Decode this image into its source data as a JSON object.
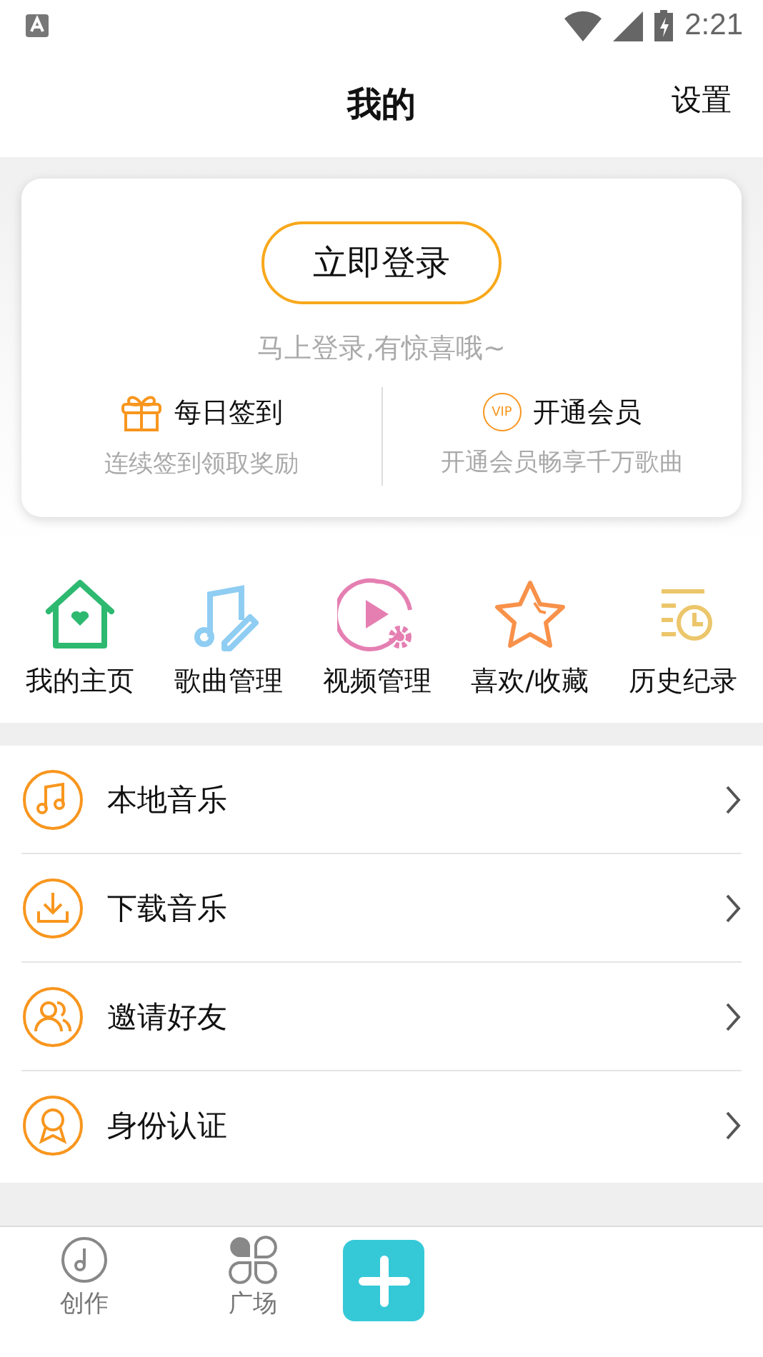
{
  "status_bar": {
    "time": "2:21"
  },
  "header": {
    "title": "我的",
    "action": "设置"
  },
  "login_card": {
    "button": "立即登录",
    "hint": "马上登录,有惊喜哦~",
    "features": [
      {
        "kind": "gift",
        "title": "每日签到",
        "subtitle": "连续签到领取奖励"
      },
      {
        "kind": "vip",
        "badge": "VIP",
        "title": "开通会员",
        "subtitle": "开通会员畅享千万歌曲"
      }
    ]
  },
  "shortcuts": [
    {
      "kind": "home",
      "label": "我的主页"
    },
    {
      "kind": "music",
      "label": "歌曲管理"
    },
    {
      "kind": "video",
      "label": "视频管理"
    },
    {
      "kind": "star",
      "label": "喜欢/收藏"
    },
    {
      "kind": "history",
      "label": "历史纪录"
    }
  ],
  "menu": [
    {
      "kind": "music",
      "label": "本地音乐"
    },
    {
      "kind": "download",
      "label": "下载音乐"
    },
    {
      "kind": "invite",
      "label": "邀请好友"
    },
    {
      "kind": "identity",
      "label": "身份认证"
    }
  ],
  "bottom_nav": [
    {
      "kind": "disc",
      "label": "创作"
    },
    {
      "kind": "clover",
      "label": "广场"
    },
    {
      "kind": "plus"
    }
  ]
}
